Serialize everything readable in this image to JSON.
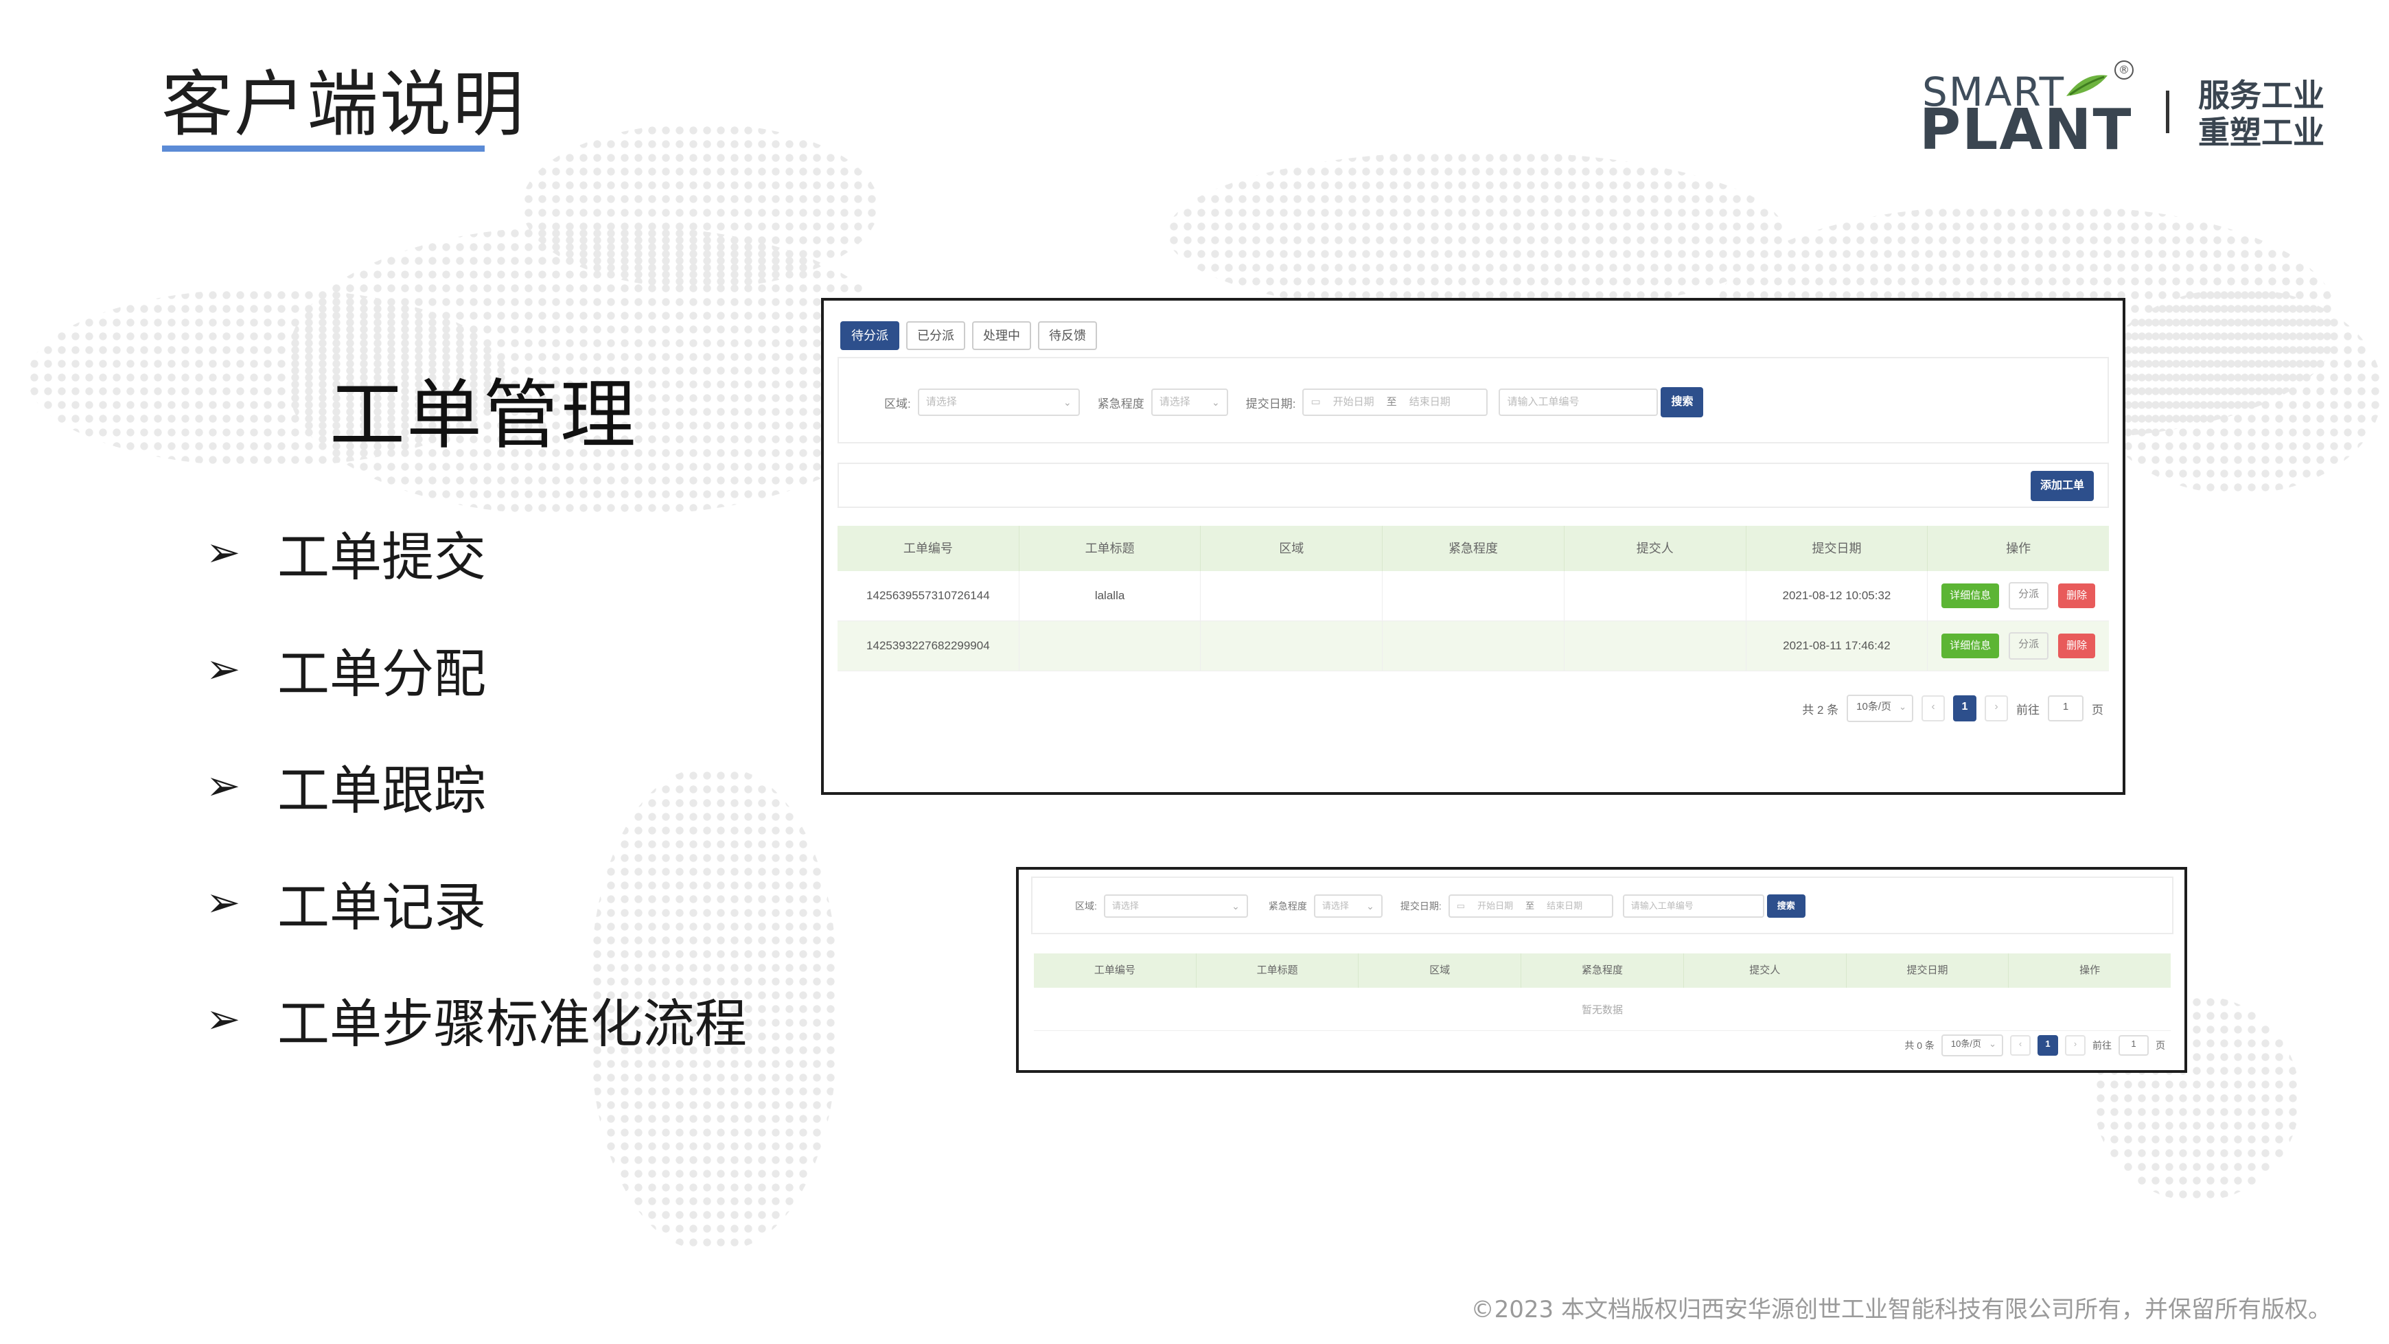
{
  "page": {
    "title": "客户端说明"
  },
  "logo": {
    "line1": "SMART",
    "line2": "PLANT",
    "registered": "®",
    "slogan_line1": "服务工业",
    "slogan_line2": "重塑工业"
  },
  "section": {
    "heading": "工单管理",
    "bullets": [
      "工单提交",
      "工单分配",
      "工单跟踪",
      "工单记录",
      "工单步骤标准化流程"
    ],
    "bullet_marker": "➢"
  },
  "panel_a": {
    "tabs": [
      "待分派",
      "已分派",
      "处理中",
      "待反馈"
    ],
    "active_tab_index": 0,
    "filters": {
      "region_label": "区域:",
      "region_placeholder": "请选择",
      "urgency_label": "紧急程度",
      "urgency_placeholder": "请选择",
      "date_label": "提交日期:",
      "date_start_placeholder": "开始日期",
      "date_sep": "至",
      "date_end_placeholder": "结束日期",
      "order_no_placeholder": "请输入工单编号",
      "search_button": "搜索"
    },
    "add_button": "添加工单",
    "table": {
      "columns": [
        "工单编号",
        "工单标题",
        "区域",
        "紧急程度",
        "提交人",
        "提交日期",
        "操作"
      ],
      "rows": [
        {
          "order_no": "1425639557310726144",
          "title": "lalalla",
          "region": "",
          "urgency": "",
          "submitter": "",
          "date": "2021-08-12 10:05:32"
        },
        {
          "order_no": "1425393227682299904",
          "title": "",
          "region": "",
          "urgency": "",
          "submitter": "",
          "date": "2021-08-11 17:46:42"
        }
      ],
      "actions": {
        "detail": "详细信息",
        "assign": "分派",
        "delete": "删除"
      }
    },
    "pagination": {
      "total": "共 2 条",
      "page_size": "10条/页",
      "prev": "‹",
      "current": "1",
      "next": "›",
      "goto_label": "前往",
      "goto_value": "1",
      "page_suffix": "页"
    }
  },
  "panel_b": {
    "filters": {
      "region_label": "区域:",
      "region_placeholder": "请选择",
      "urgency_label": "紧急程度",
      "urgency_placeholder": "请选择",
      "date_label": "提交日期:",
      "date_start_placeholder": "开始日期",
      "date_sep": "至",
      "date_end_placeholder": "结束日期",
      "order_no_placeholder": "请输入工单编号",
      "search_button": "搜索"
    },
    "table": {
      "columns": [
        "工单编号",
        "工单标题",
        "区域",
        "紧急程度",
        "提交人",
        "提交日期",
        "操作"
      ],
      "empty_text": "暂无数据"
    },
    "pagination": {
      "total": "共 0 条",
      "page_size": "10条/页",
      "prev": "‹",
      "current": "1",
      "next": "›",
      "goto_label": "前往",
      "goto_value": "1",
      "page_suffix": "页"
    }
  },
  "footer": {
    "copyright": "©2023 本文档版权归西安华源创世工业智能科技有限公司所有，并保留所有版权。"
  },
  "colors": {
    "accent_blue": "#2d4f8c",
    "underline_blue": "#5b8bd6",
    "header_green": "#e8f3e0",
    "btn_green": "#5cb534",
    "btn_red": "#e85b5b"
  }
}
